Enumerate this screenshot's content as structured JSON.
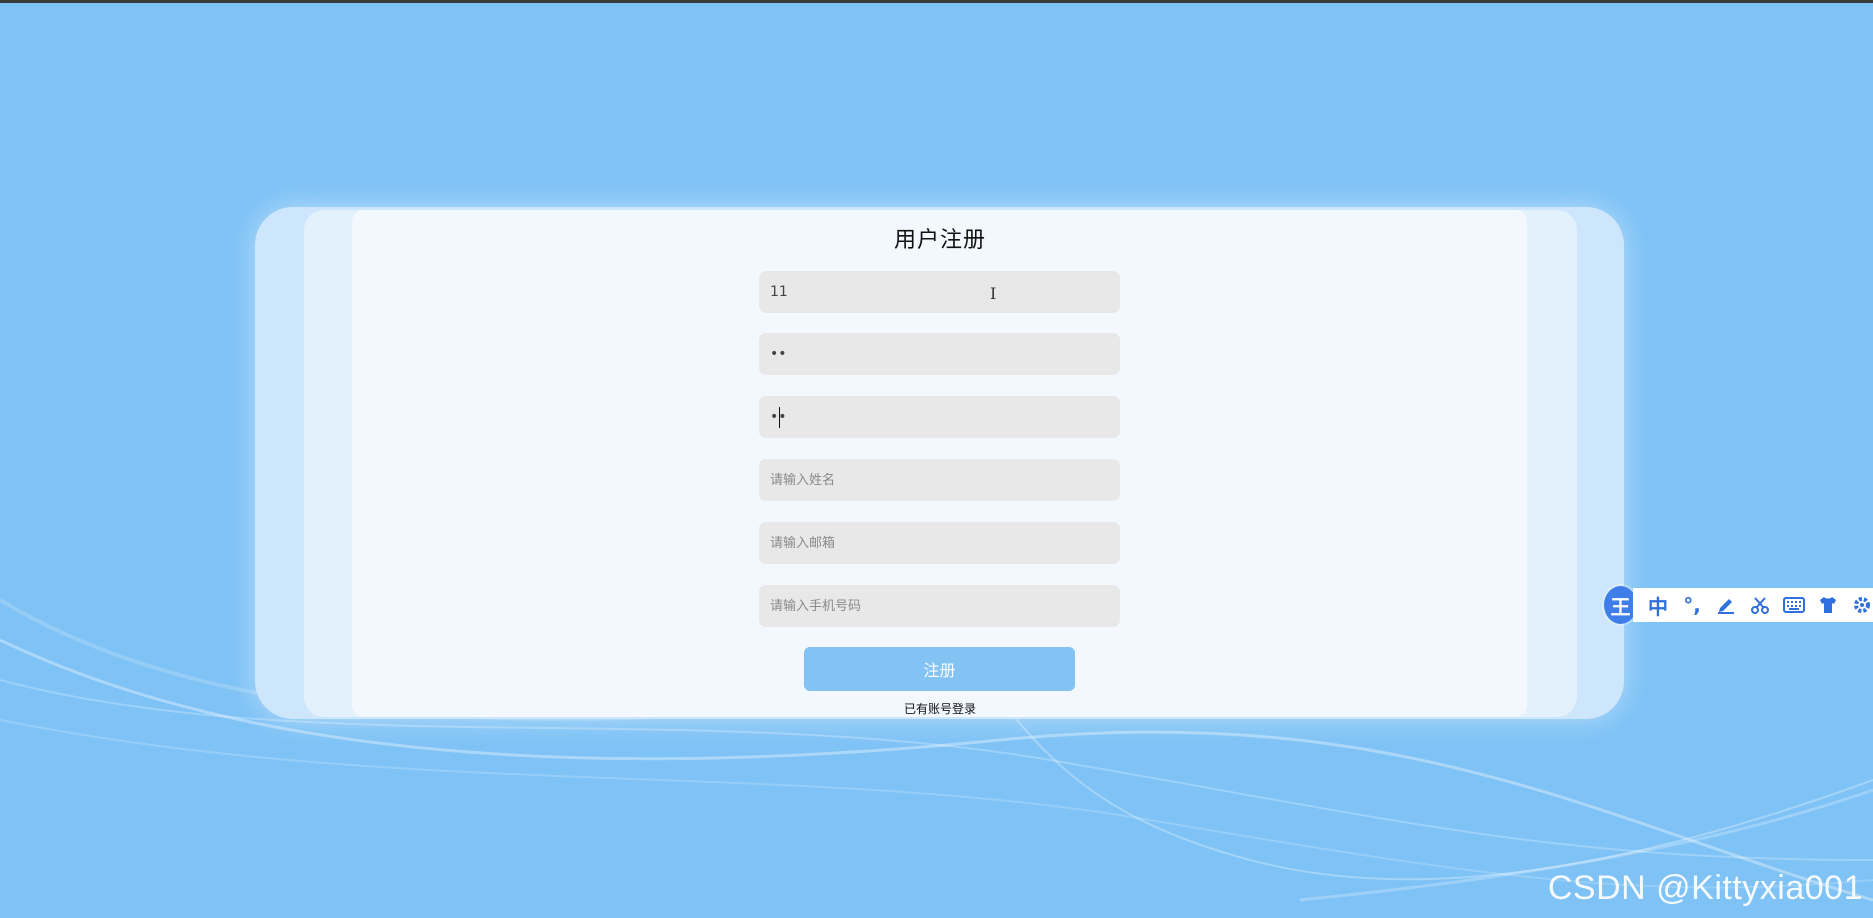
{
  "page": {
    "title": "用户注册",
    "background_color": "#7ec2f6",
    "accent_color": "#82c3f4"
  },
  "form": {
    "fields": [
      {
        "name": "username",
        "value": "11",
        "placeholder": "",
        "type": "text"
      },
      {
        "name": "password",
        "value": "11",
        "placeholder": "",
        "type": "password"
      },
      {
        "name": "confirm_password",
        "value": "11",
        "placeholder": "",
        "type": "password"
      },
      {
        "name": "real_name",
        "value": "",
        "placeholder": "请输入姓名",
        "type": "text"
      },
      {
        "name": "email",
        "value": "",
        "placeholder": "请输入邮箱",
        "type": "text"
      },
      {
        "name": "phone",
        "value": "",
        "placeholder": "请输入手机号码",
        "type": "text"
      }
    ],
    "submit_label": "注册",
    "login_link": "已有账号登录"
  },
  "ime_toolbar": {
    "logo": "王",
    "icons": [
      "中",
      "°,",
      "pen-icon",
      "scissors-icon",
      "keyboard-icon",
      "shirt-icon",
      "gear-icon"
    ]
  },
  "watermark": "CSDN @Kittyxia001"
}
